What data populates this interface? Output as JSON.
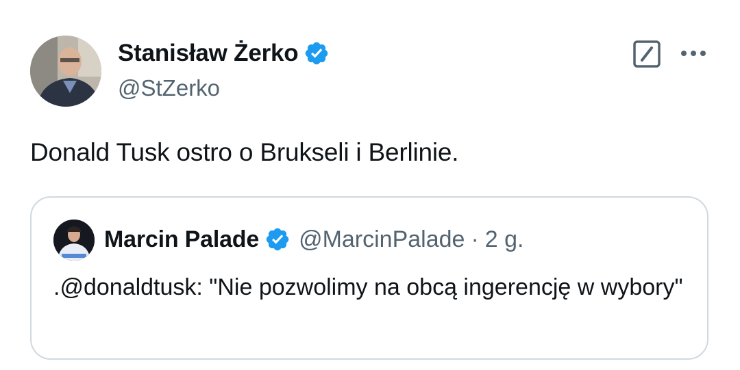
{
  "tweet": {
    "author": {
      "display_name": "Stanisław Żerko",
      "handle": "@StZerko",
      "verified": true
    },
    "text": "Donald Tusk ostro o Brukseli i Berlinie.",
    "icons": [
      "verified-badge-icon",
      "edit-icon",
      "more-icon"
    ]
  },
  "quote": {
    "author": {
      "display_name": "Marcin Palade",
      "handle": "@MarcinPalade",
      "verified": true
    },
    "separator": "·",
    "time": "2 g.",
    "text": ".@donaldtusk: \"Nie pozwolimy na obcą ingerencję w wybory\""
  },
  "colors": {
    "text_primary": "#0f1419",
    "text_secondary": "#536471",
    "verified_blue": "#1d9bf0",
    "card_border": "#cfd9de"
  }
}
